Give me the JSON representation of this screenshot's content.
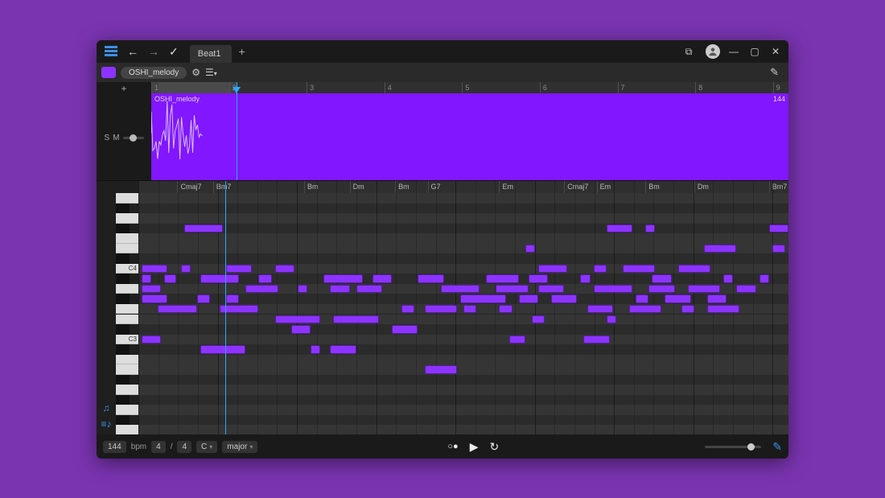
{
  "colors": {
    "accent": "#8d33ff",
    "playhead": "#2aa9ff",
    "highlight": "#3c90e8"
  },
  "titlebar": {
    "back_enabled": true,
    "tab_label": "Beat1"
  },
  "track": {
    "name": "OSHI_melody",
    "solo_label": "S",
    "mute_label": "M",
    "clip_label": "OSHI_melody",
    "clip_badge": "144"
  },
  "timeline": {
    "bars": [
      1,
      2,
      3,
      4,
      5,
      6,
      7,
      8,
      9
    ],
    "loop_start_bar": 1,
    "loop_end_bar": 2,
    "playhead_bar": 2.1,
    "total_bars": 8.2
  },
  "chords": [
    {
      "pos": 0.06,
      "label": "Cmaj7"
    },
    {
      "pos": 0.115,
      "label": "Bm7"
    },
    {
      "pos": 0.255,
      "label": "Bm"
    },
    {
      "pos": 0.325,
      "label": "Dm"
    },
    {
      "pos": 0.395,
      "label": "Bm"
    },
    {
      "pos": 0.445,
      "label": "G7"
    },
    {
      "pos": 0.555,
      "label": "Em"
    },
    {
      "pos": 0.655,
      "label": "Cmaj7"
    },
    {
      "pos": 0.705,
      "label": "Em"
    },
    {
      "pos": 0.78,
      "label": "Bm"
    },
    {
      "pos": 0.855,
      "label": "Dm"
    },
    {
      "pos": 0.97,
      "label": "Bm7"
    }
  ],
  "piano": {
    "row_count": 24,
    "labels": [
      {
        "row": 7,
        "text": "C4"
      },
      {
        "row": 14,
        "text": "C3"
      }
    ],
    "black_rows": [
      1,
      3,
      6,
      8,
      10,
      13,
      15,
      18,
      20,
      22
    ],
    "notes": [
      {
        "r": 3,
        "x": 0.07,
        "w": 0.06
      },
      {
        "r": 3,
        "x": 0.72,
        "w": 0.04
      },
      {
        "r": 3,
        "x": 0.78,
        "w": 0.015
      },
      {
        "r": 3,
        "x": 0.97,
        "w": 0.03
      },
      {
        "r": 5,
        "x": 0.595,
        "w": 0.015
      },
      {
        "r": 5,
        "x": 0.87,
        "w": 0.05
      },
      {
        "r": 5,
        "x": 0.975,
        "w": 0.02
      },
      {
        "r": 7,
        "x": 0.005,
        "w": 0.04
      },
      {
        "r": 7,
        "x": 0.065,
        "w": 0.015
      },
      {
        "r": 7,
        "x": 0.135,
        "w": 0.04
      },
      {
        "r": 7,
        "x": 0.21,
        "w": 0.03
      },
      {
        "r": 7,
        "x": 0.615,
        "w": 0.045
      },
      {
        "r": 7,
        "x": 0.7,
        "w": 0.02
      },
      {
        "r": 7,
        "x": 0.745,
        "w": 0.05
      },
      {
        "r": 7,
        "x": 0.83,
        "w": 0.05
      },
      {
        "r": 8,
        "x": 0.005,
        "w": 0.015
      },
      {
        "r": 8,
        "x": 0.04,
        "w": 0.018
      },
      {
        "r": 8,
        "x": 0.095,
        "w": 0.06
      },
      {
        "r": 8,
        "x": 0.185,
        "w": 0.02
      },
      {
        "r": 8,
        "x": 0.285,
        "w": 0.06
      },
      {
        "r": 8,
        "x": 0.36,
        "w": 0.03
      },
      {
        "r": 8,
        "x": 0.43,
        "w": 0.04
      },
      {
        "r": 8,
        "x": 0.535,
        "w": 0.05
      },
      {
        "r": 8,
        "x": 0.6,
        "w": 0.03
      },
      {
        "r": 8,
        "x": 0.68,
        "w": 0.015
      },
      {
        "r": 8,
        "x": 0.79,
        "w": 0.03
      },
      {
        "r": 8,
        "x": 0.9,
        "w": 0.015
      },
      {
        "r": 8,
        "x": 0.955,
        "w": 0.015
      },
      {
        "r": 9,
        "x": 0.005,
        "w": 0.03
      },
      {
        "r": 9,
        "x": 0.165,
        "w": 0.05
      },
      {
        "r": 9,
        "x": 0.245,
        "w": 0.015
      },
      {
        "r": 9,
        "x": 0.295,
        "w": 0.03
      },
      {
        "r": 9,
        "x": 0.335,
        "w": 0.04
      },
      {
        "r": 9,
        "x": 0.465,
        "w": 0.06
      },
      {
        "r": 9,
        "x": 0.55,
        "w": 0.05
      },
      {
        "r": 9,
        "x": 0.615,
        "w": 0.04
      },
      {
        "r": 9,
        "x": 0.7,
        "w": 0.06
      },
      {
        "r": 9,
        "x": 0.785,
        "w": 0.04
      },
      {
        "r": 9,
        "x": 0.845,
        "w": 0.05
      },
      {
        "r": 9,
        "x": 0.92,
        "w": 0.03
      },
      {
        "r": 10,
        "x": 0.005,
        "w": 0.04
      },
      {
        "r": 10,
        "x": 0.09,
        "w": 0.02
      },
      {
        "r": 10,
        "x": 0.135,
        "w": 0.02
      },
      {
        "r": 10,
        "x": 0.495,
        "w": 0.07
      },
      {
        "r": 10,
        "x": 0.585,
        "w": 0.03
      },
      {
        "r": 10,
        "x": 0.635,
        "w": 0.04
      },
      {
        "r": 10,
        "x": 0.765,
        "w": 0.02
      },
      {
        "r": 10,
        "x": 0.81,
        "w": 0.04
      },
      {
        "r": 10,
        "x": 0.875,
        "w": 0.03
      },
      {
        "r": 11,
        "x": 0.03,
        "w": 0.06
      },
      {
        "r": 11,
        "x": 0.125,
        "w": 0.06
      },
      {
        "r": 11,
        "x": 0.405,
        "w": 0.02
      },
      {
        "r": 11,
        "x": 0.44,
        "w": 0.05
      },
      {
        "r": 11,
        "x": 0.5,
        "w": 0.02
      },
      {
        "r": 11,
        "x": 0.555,
        "w": 0.02
      },
      {
        "r": 11,
        "x": 0.69,
        "w": 0.04
      },
      {
        "r": 11,
        "x": 0.755,
        "w": 0.05
      },
      {
        "r": 11,
        "x": 0.835,
        "w": 0.02
      },
      {
        "r": 11,
        "x": 0.875,
        "w": 0.05
      },
      {
        "r": 12,
        "x": 0.21,
        "w": 0.07
      },
      {
        "r": 12,
        "x": 0.3,
        "w": 0.07
      },
      {
        "r": 12,
        "x": 0.605,
        "w": 0.02
      },
      {
        "r": 12,
        "x": 0.72,
        "w": 0.015
      },
      {
        "r": 13,
        "x": 0.235,
        "w": 0.03
      },
      {
        "r": 13,
        "x": 0.39,
        "w": 0.04
      },
      {
        "r": 14,
        "x": 0.005,
        "w": 0.03
      },
      {
        "r": 14,
        "x": 0.57,
        "w": 0.025
      },
      {
        "r": 14,
        "x": 0.685,
        "w": 0.04
      },
      {
        "r": 15,
        "x": 0.095,
        "w": 0.07
      },
      {
        "r": 15,
        "x": 0.265,
        "w": 0.015
      },
      {
        "r": 15,
        "x": 0.295,
        "w": 0.04
      },
      {
        "r": 17,
        "x": 0.44,
        "w": 0.05
      }
    ]
  },
  "transport": {
    "bpm_value": "144",
    "bpm_label": "bpm",
    "sig_num": "4",
    "sig_sep": "/",
    "sig_den": "4",
    "key_root": "C",
    "key_mode": "major"
  }
}
